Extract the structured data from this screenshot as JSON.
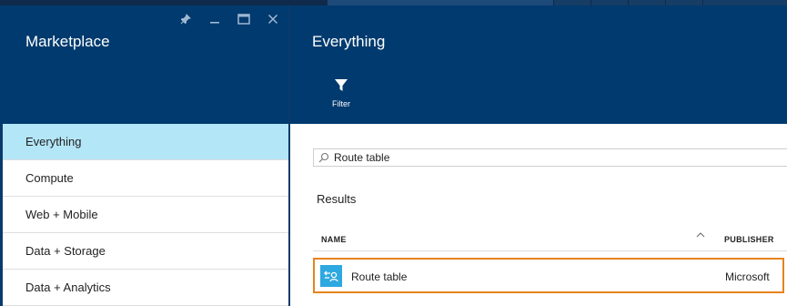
{
  "marketplace": {
    "title": "Marketplace",
    "categories": [
      {
        "label": "Everything",
        "active": true
      },
      {
        "label": "Compute",
        "active": false
      },
      {
        "label": "Web + Mobile",
        "active": false
      },
      {
        "label": "Data + Storage",
        "active": false
      },
      {
        "label": "Data + Analytics",
        "active": false
      }
    ],
    "window_controls": [
      "pin-icon",
      "minimize-icon",
      "maximize-icon",
      "close-icon"
    ]
  },
  "everything": {
    "title": "Everything",
    "filter_label": "Filter",
    "search": {
      "value": "Route table"
    },
    "results_title": "Results",
    "columns": {
      "name": "NAME",
      "publisher": "PUBLISHER"
    },
    "rows": [
      {
        "name": "Route table",
        "publisher": "Microsoft",
        "icon": "route-table-icon",
        "selected": true
      }
    ]
  },
  "colors": {
    "header_bg": "#003a6e",
    "active_item": "#b3e6f7",
    "selection_outline": "#e8821e",
    "resource_icon_bg": "#2ea8e0"
  }
}
